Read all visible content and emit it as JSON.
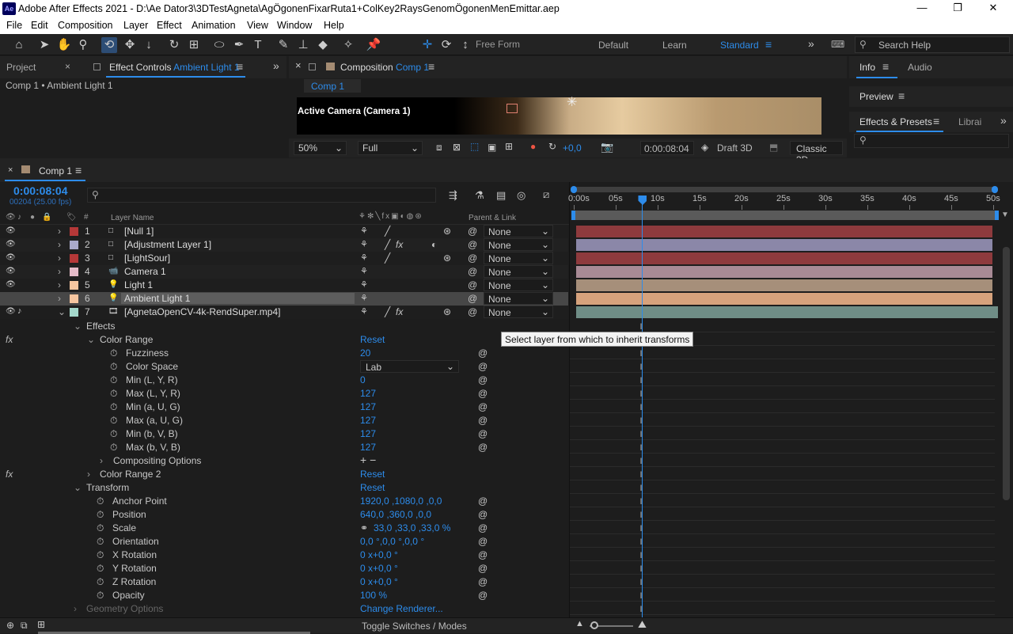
{
  "window": {
    "title": "Adobe After Effects 2021 - D:\\Ae Dator3\\3DTestAgneta\\AgÖgonenFixarRuta1+ColKey2RaysGenomÖgonenMenEmittar.aep",
    "app_badge": "Ae",
    "controls": [
      "minimize-icon",
      "maximize-icon",
      "close-icon"
    ]
  },
  "menu": [
    "File",
    "Edit",
    "Composition",
    "Layer",
    "Effect",
    "Animation",
    "View",
    "Window",
    "Help"
  ],
  "toolbar": {
    "free_form": "Free Form",
    "workspaces": [
      "Default",
      "Learn",
      "Standard"
    ],
    "search_placeholder": "Search Help",
    "tools": [
      "home-icon",
      "selection-icon",
      "hand-icon",
      "zoom-icon",
      "orbit-icon",
      "pan-icon",
      "dolly-icon",
      "rotate-icon",
      "pan-behind-icon",
      "rectangle-icon",
      "pen-icon",
      "type-icon",
      "brush-icon",
      "clone-stamp-icon",
      "eraser-icon",
      "roto-brush-icon",
      "puppet-pin-icon"
    ]
  },
  "left_panel": {
    "tab_project": "Project",
    "tab_effect_controls": "Effect Controls",
    "effect_controls_target": "Ambient Light 1",
    "breadcrumb": "Comp 1 • Ambient Light 1"
  },
  "comp_panel": {
    "tab_label": "Composition",
    "comp_name": "Comp 1",
    "subtab": "Comp 1",
    "camera_label": "Active Camera (Camera 1)",
    "zoom": "50%",
    "resolution": "Full",
    "exposure": "+0,0",
    "timecode": "0:00:08:04",
    "draft": "Draft 3D",
    "renderer": "Classic 3D"
  },
  "right_panel": {
    "info": "Info",
    "audio": "Audio",
    "preview": "Preview",
    "effects_presets": "Effects & Presets",
    "libraries": "Librai",
    "search_placeholder": ""
  },
  "timeline": {
    "tab": "Comp 1",
    "timecode": "0:00:08:04",
    "frame_info": "00204 (25.00 fps)",
    "search_placeholder": "",
    "col_layer_name": "Layer Name",
    "col_num": "#",
    "col_parent": "Parent & Link",
    "ruler": [
      "0:00s",
      "05s",
      "10s",
      "15s",
      "20s",
      "25s",
      "30s",
      "35s",
      "40s",
      "45s",
      "50s"
    ],
    "playhead_seconds": 8.16,
    "tooltip": "Select layer from which to inherit transforms",
    "toggle_label": "Toggle Switches / Modes",
    "layers": [
      {
        "num": "1",
        "name": "[Null 1]",
        "label_color": "#b53838",
        "parent": "None",
        "bar_color": "#8e3a3d"
      },
      {
        "num": "2",
        "name": "[Adjustment Layer 1]",
        "label_color": "#a9a9ca",
        "parent": "None",
        "bar_color": "#8b87a8",
        "fx": "fx"
      },
      {
        "num": "3",
        "name": "[LightSour]",
        "label_color": "#b53838",
        "parent": "None",
        "bar_color": "#8e3a3d"
      },
      {
        "num": "4",
        "name": "Camera 1",
        "label_color": "#e5bcc9",
        "parent": "None",
        "bar_color": "#a88a95"
      },
      {
        "num": "5",
        "name": "Light 1",
        "label_color": "#f6c6a0",
        "parent": "None",
        "bar_color": "#a68f7a"
      },
      {
        "num": "6",
        "name": "Ambient Light 1",
        "label_color": "#f6c6a0",
        "parent": "None",
        "bar_color": "#d6a27c"
      },
      {
        "num": "7",
        "name": "[AgnetaOpenCV-4k-RendSuper.mp4]",
        "label_color": "#a4d8cb",
        "parent": "None",
        "bar_color": "#6f8d86",
        "fx": "fx"
      }
    ],
    "props": {
      "effects": "Effects",
      "fx": "fx",
      "color_range": "Color Range",
      "reset": "Reset",
      "items": [
        {
          "label": "Fuzziness",
          "value": "20"
        },
        {
          "label": "Color Space",
          "value": "Lab"
        },
        {
          "label": "Min (L, Y, R)",
          "value": "0"
        },
        {
          "label": "Max (L, Y, R)",
          "value": "127"
        },
        {
          "label": "Min (a, U, G)",
          "value": "127"
        },
        {
          "label": "Max (a, U, G)",
          "value": "127"
        },
        {
          "label": "Min (b, V, B)",
          "value": "127"
        },
        {
          "label": "Max (b, V, B)",
          "value": "127"
        }
      ],
      "compositing": "Compositing Options",
      "plusminus": "+ −",
      "color_range2": "Color Range 2",
      "transform": "Transform",
      "transform_items": [
        {
          "label": "Anchor Point",
          "value": "1920,0 ,1080,0 ,0,0"
        },
        {
          "label": "Position",
          "value": "640,0 ,360,0 ,0,0"
        },
        {
          "label": "Scale",
          "value": "33,0 ,33,0 ,33,0 %"
        },
        {
          "label": "Orientation",
          "value": "0,0 °,0,0 °,0,0 °"
        },
        {
          "label": "X Rotation",
          "value": "0 x+0,0 °"
        },
        {
          "label": "Y Rotation",
          "value": "0 x+0,0 °"
        },
        {
          "label": "Z Rotation",
          "value": "0 x+0,0 °"
        },
        {
          "label": "Opacity",
          "value": "100 %"
        }
      ],
      "geometry": "Geometry Options",
      "change_renderer": "Change Renderer..."
    }
  }
}
